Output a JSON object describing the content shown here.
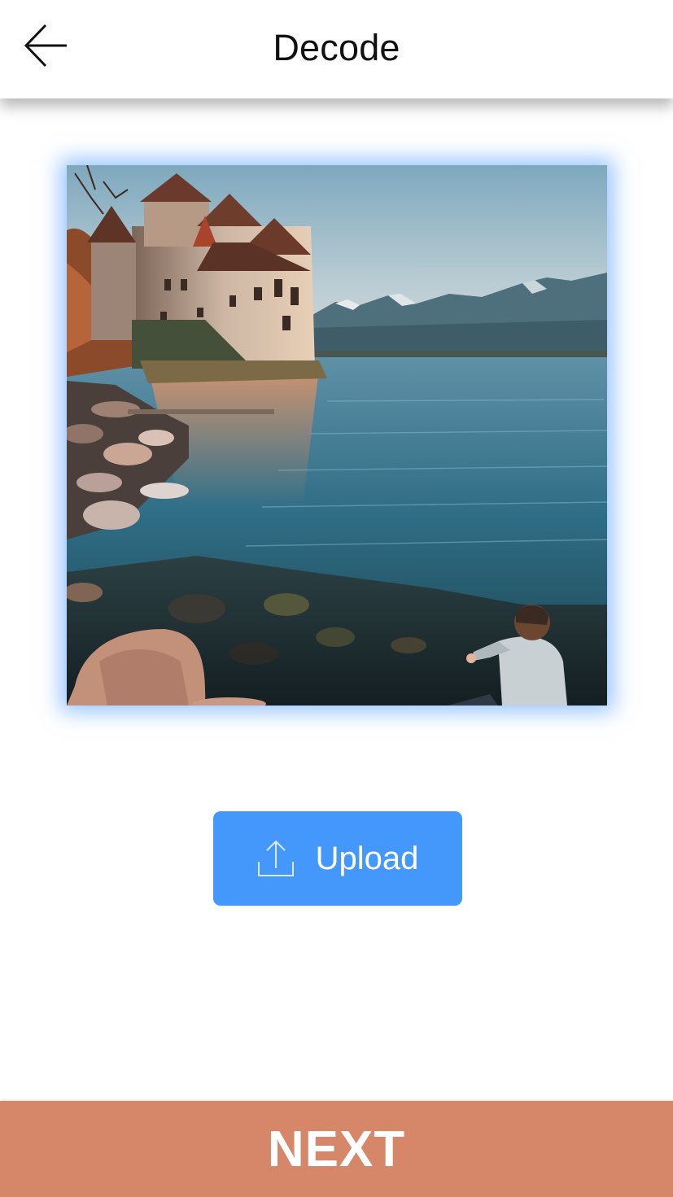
{
  "header": {
    "title": "Decode",
    "back_icon": "arrow-left-icon"
  },
  "image": {
    "subject": "lakeside castle landscape photo"
  },
  "upload": {
    "label": "Upload",
    "icon": "upload-icon",
    "color": "#4598fb"
  },
  "next": {
    "label": "NEXT",
    "color": "#d68769"
  }
}
